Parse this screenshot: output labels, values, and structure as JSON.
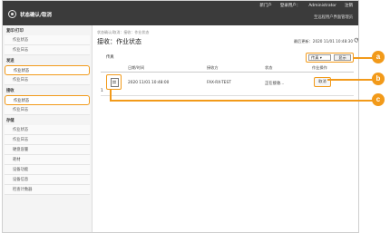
{
  "header": {
    "links": [
      "新门户",
      "登录用户：",
      "Administrator",
      "注销"
    ],
    "subtitle": "至远程用户界面管理员",
    "title": "状态确认/取消"
  },
  "sidebar": {
    "groups": [
      {
        "title": "复印/打印",
        "items": [
          {
            "label": "作业状态",
            "selected": false
          },
          {
            "label": "作业日志",
            "selected": false
          }
        ]
      },
      {
        "title": "发送",
        "items": [
          {
            "label": "作业状态",
            "selected": true
          },
          {
            "label": "作业日志",
            "selected": false
          }
        ]
      },
      {
        "title": "接收",
        "items": [
          {
            "label": "作业状态",
            "selected": true
          },
          {
            "label": "作业日志",
            "selected": false
          }
        ]
      },
      {
        "title": "存储",
        "items": [
          {
            "label": "作业状态",
            "selected": false
          },
          {
            "label": "作业日志",
            "selected": false
          },
          {
            "label": "硬盘容量",
            "selected": false
          },
          {
            "label": "耗材",
            "selected": false
          },
          {
            "label": "设备功能",
            "selected": false
          },
          {
            "label": "设备信息",
            "selected": false
          },
          {
            "label": "检查计数器",
            "selected": false
          }
        ]
      }
    ]
  },
  "main": {
    "breadcrumb": "状态确认/取消：接收：作业状态",
    "title": "接收：作业状态",
    "updated": "最后更新：2020 11/01 10:48:30",
    "sub_label": "传真",
    "filter": {
      "selected": "传真",
      "show_label": "显示"
    },
    "columns": [
      "日期/时间",
      "接收方",
      "状态",
      "作业操作"
    ],
    "rows": [
      {
        "datetime": "2020 11/01 10:48:00",
        "recipient": "FAX-RX-TEST",
        "status": "正在接收...",
        "action": "取消"
      }
    ],
    "total": "1"
  },
  "callouts": [
    "a",
    "b",
    "c"
  ],
  "colors": {
    "accent": "#f29a1a",
    "topbar": "#3b3b3b"
  }
}
